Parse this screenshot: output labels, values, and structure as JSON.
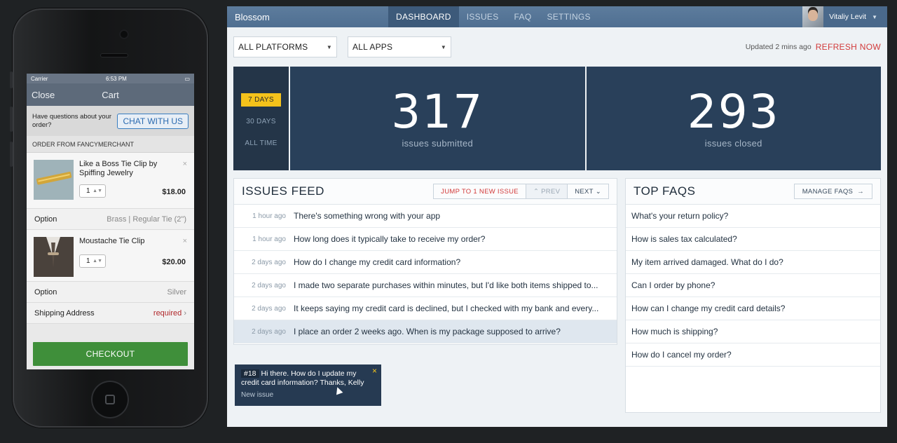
{
  "phone": {
    "status": {
      "carrier": "Carrier",
      "time": "6:53 PM"
    },
    "nav": {
      "close_label": "Close",
      "title": "Cart"
    },
    "chat": {
      "question": "Have questions about your order?",
      "button": "CHAT WITH US"
    },
    "order_header": "ORDER FROM FANCYMERCHANT",
    "items": [
      {
        "name": "Like a Boss Tie Clip by Spiffing Jewelry",
        "qty": "1",
        "price": "$18.00",
        "option_label": "Option",
        "option_value": "Brass | Regular Tie (2\")"
      },
      {
        "name": "Moustache Tie Clip",
        "qty": "1",
        "price": "$20.00",
        "option_label": "Option",
        "option_value": "Silver"
      }
    ],
    "remove_glyph": "×",
    "shipping": {
      "label": "Shipping Address",
      "value": "required"
    },
    "checkout": "CHECKOUT"
  },
  "app": {
    "brand": "Blossom",
    "tabs": [
      "DASHBOARD",
      "ISSUES",
      "FAQ",
      "SETTINGS"
    ],
    "user": "Vitaliy Levit",
    "filters": {
      "platform": "ALL PLATFORMS",
      "apps": "ALL APPS"
    },
    "updated": "Updated 2 mins ago",
    "refresh": "REFRESH NOW",
    "periods": [
      "7 DAYS",
      "30 DAYS",
      "ALL TIME"
    ],
    "stats": [
      {
        "value": "317",
        "label": "issues submitted"
      },
      {
        "value": "293",
        "label": "issues closed"
      }
    ],
    "feed": {
      "title": "ISSUES FEED",
      "jump": "JUMP TO 1 NEW ISSUE",
      "prev": "PREV",
      "next": "NEXT",
      "rows": [
        {
          "time": "1 hour ago",
          "text": "There's something wrong with your app"
        },
        {
          "time": "1 hour ago",
          "text": "How long does it typically take to receive my order?"
        },
        {
          "time": "2 days ago",
          "text": "How do I change my credit card information?"
        },
        {
          "time": "2 days ago",
          "text": "I made two separate purchases within minutes, but I'd like both items shipped to..."
        },
        {
          "time": "2 days ago",
          "text": "It keeps saying my credit card is declined, but I checked with my bank and every..."
        },
        {
          "time": "2 days ago",
          "text": "I place an order 2 weeks ago. When is my package supposed to arrive?"
        }
      ]
    },
    "faqs": {
      "title": "TOP FAQS",
      "manage": "MANAGE FAQS",
      "items": [
        "What's your return policy?",
        "How is sales tax calculated?",
        "My item arrived damaged. What do I do?",
        "Can I order by phone?",
        "How can I change my credit card details?",
        "How much is shipping?",
        "How do I cancel my order?"
      ]
    },
    "toast": {
      "tag": "#18",
      "message": "Hi there. How do I update my credit card information? Thanks, Kelly",
      "sub": "New issue",
      "close": "×"
    }
  }
}
